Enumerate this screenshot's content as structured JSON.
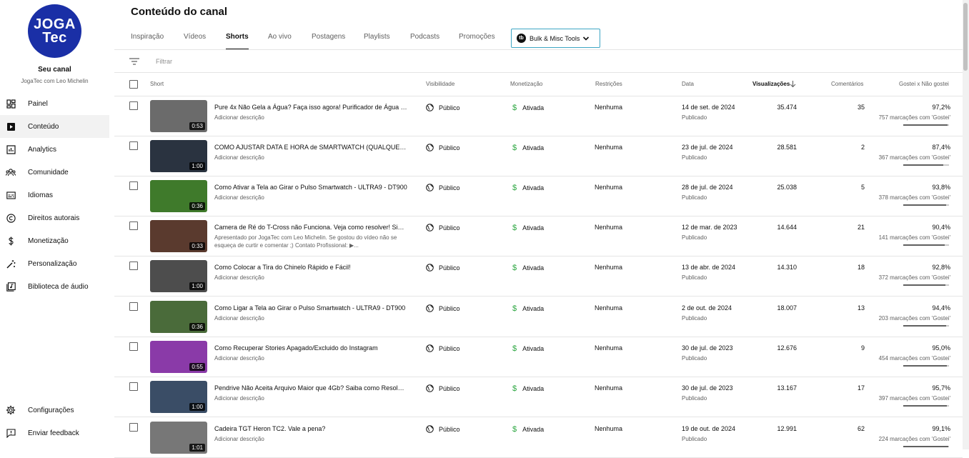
{
  "channel": {
    "avatar_line1": "JOGA",
    "avatar_line2": "Tec",
    "title": "Seu canal",
    "subtitle": "JogaTec com Leo Michelin"
  },
  "nav": {
    "items": [
      {
        "label": "Painel",
        "icon": "dashboard-icon"
      },
      {
        "label": "Conteúdo",
        "icon": "content-icon",
        "active": true
      },
      {
        "label": "Analytics",
        "icon": "analytics-icon"
      },
      {
        "label": "Comunidade",
        "icon": "community-icon"
      },
      {
        "label": "Idiomas",
        "icon": "subtitles-icon"
      },
      {
        "label": "Direitos autorais",
        "icon": "copyright-icon"
      },
      {
        "label": "Monetização",
        "icon": "dollar-icon"
      },
      {
        "label": "Personalização",
        "icon": "magic-wand-icon"
      },
      {
        "label": "Biblioteca de áudio",
        "icon": "audio-library-icon"
      }
    ],
    "bottom": [
      {
        "label": "Configurações",
        "icon": "gear-icon"
      },
      {
        "label": "Enviar feedback",
        "icon": "feedback-icon"
      }
    ]
  },
  "page": {
    "title": "Conteúdo do canal",
    "tabs": [
      "Inspiração",
      "Vídeos",
      "Shorts",
      "Ao vivo",
      "Postagens",
      "Playlists",
      "Podcasts",
      "Promoções"
    ],
    "active_tab": "Shorts",
    "bulk_label": "Bulk & Misc Tools",
    "filter_placeholder": "Filtrar"
  },
  "columns": {
    "short": "Short",
    "visibility": "Visibilidade",
    "monetization": "Monetização",
    "restrictions": "Restrições",
    "date": "Data",
    "views": "Visualizações",
    "comments": "Comentários",
    "likes": "Gostei x Não gostei"
  },
  "rows": [
    {
      "title": "Pure 4x Não Gela a Água? Faça isso agora! Purificador de Água El...",
      "desc": "Adicionar descrição",
      "duration": "0:53",
      "visibility": "Público",
      "monetization": "Ativada",
      "restrictions": "Nenhuma",
      "date": "14 de set. de 2024",
      "status": "Publicado",
      "views": "35.474",
      "comments": "35",
      "likes": "97,2%",
      "likes_count": "757 marcações com 'Gostei'",
      "ratio": 0.972,
      "thumb": "#6b6b6b"
    },
    {
      "title": "COMO AJUSTAR DATA E HORA de SMARTWATCH (QUALQUER M...",
      "desc": "Adicionar descrição",
      "duration": "1:00",
      "visibility": "Público",
      "monetization": "Ativada",
      "restrictions": "Nenhuma",
      "date": "23 de jul. de 2024",
      "status": "Publicado",
      "views": "28.581",
      "comments": "2",
      "likes": "87,4%",
      "likes_count": "367 marcações com 'Gostei'",
      "ratio": 0.874,
      "thumb": "#2a3340"
    },
    {
      "title": "Como Ativar a Tela ao Girar o Pulso Smartwatch - ULTRA9 - DT900",
      "desc": "Adicionar descrição",
      "duration": "0:36",
      "visibility": "Público",
      "monetization": "Ativada",
      "restrictions": "Nenhuma",
      "date": "28 de jul. de 2024",
      "status": "Publicado",
      "views": "25.038",
      "comments": "5",
      "likes": "93,8%",
      "likes_count": "378 marcações com 'Gostei'",
      "ratio": 0.938,
      "thumb": "#3f7a2b"
    },
    {
      "title": "Camera de Ré do T-Cross não Funciona. Veja como resolver! Simp...",
      "desc": "Apresentado por JogaTec com Leo Michelin. Se gostou do vídeo não se esqueça de curtir e comentar ;) Contato Profissional: ▶...",
      "duration": "0:33",
      "visibility": "Público",
      "monetization": "Ativada",
      "restrictions": "Nenhuma",
      "date": "12 de mar. de 2023",
      "status": "Publicado",
      "views": "14.644",
      "comments": "21",
      "likes": "90,4%",
      "likes_count": "141 marcações com 'Gostei'",
      "ratio": 0.904,
      "thumb": "#5a3a2e"
    },
    {
      "title": "Como Colocar a Tira do Chinelo Rápido e Fácil!",
      "desc": "Adicionar descrição",
      "duration": "1:00",
      "visibility": "Público",
      "monetization": "Ativada",
      "restrictions": "Nenhuma",
      "date": "13 de abr. de 2024",
      "status": "Publicado",
      "views": "14.310",
      "comments": "18",
      "likes": "92,8%",
      "likes_count": "372 marcações com 'Gostei'",
      "ratio": 0.928,
      "thumb": "#4d4d4d"
    },
    {
      "title": "Como Ligar a Tela ao Girar o Pulso Smartwatch - ULTRA9 - DT900",
      "desc": "Adicionar descrição",
      "duration": "0:36",
      "visibility": "Público",
      "monetization": "Ativada",
      "restrictions": "Nenhuma",
      "date": "2 de out. de 2024",
      "status": "Publicado",
      "views": "18.007",
      "comments": "13",
      "likes": "94,4%",
      "likes_count": "203 marcações com 'Gostei'",
      "ratio": 0.944,
      "thumb": "#4a6b3a"
    },
    {
      "title": "Como Recuperar Stories Apagado/Excluido do Instagram",
      "desc": "Adicionar descrição",
      "duration": "0:55",
      "visibility": "Público",
      "monetization": "Ativada",
      "restrictions": "Nenhuma",
      "date": "30 de jul. de 2023",
      "status": "Publicado",
      "views": "12.676",
      "comments": "9",
      "likes": "95,0%",
      "likes_count": "454 marcações com 'Gostei'",
      "ratio": 0.95,
      "thumb": "#8a3aa8"
    },
    {
      "title": "Pendrive Não Aceita Arquivo Maior que 4Gb? Saiba como Resolve...",
      "desc": "Adicionar descrição",
      "duration": "1:00",
      "visibility": "Público",
      "monetization": "Ativada",
      "restrictions": "Nenhuma",
      "date": "30 de jul. de 2023",
      "status": "Publicado",
      "views": "13.167",
      "comments": "17",
      "likes": "95,7%",
      "likes_count": "397 marcações com 'Gostei'",
      "ratio": 0.957,
      "thumb": "#3a4d66"
    },
    {
      "title": "Cadeira TGT Heron TC2. Vale a pena?",
      "desc": "Adicionar descrição",
      "duration": "1:01",
      "visibility": "Público",
      "monetization": "Ativada",
      "restrictions": "Nenhuma",
      "date": "19 de out. de 2024",
      "status": "Publicado",
      "views": "12.991",
      "comments": "62",
      "likes": "99,1%",
      "likes_count": "224 marcações com 'Gostei'",
      "ratio": 0.991,
      "thumb": "#777777"
    }
  ]
}
